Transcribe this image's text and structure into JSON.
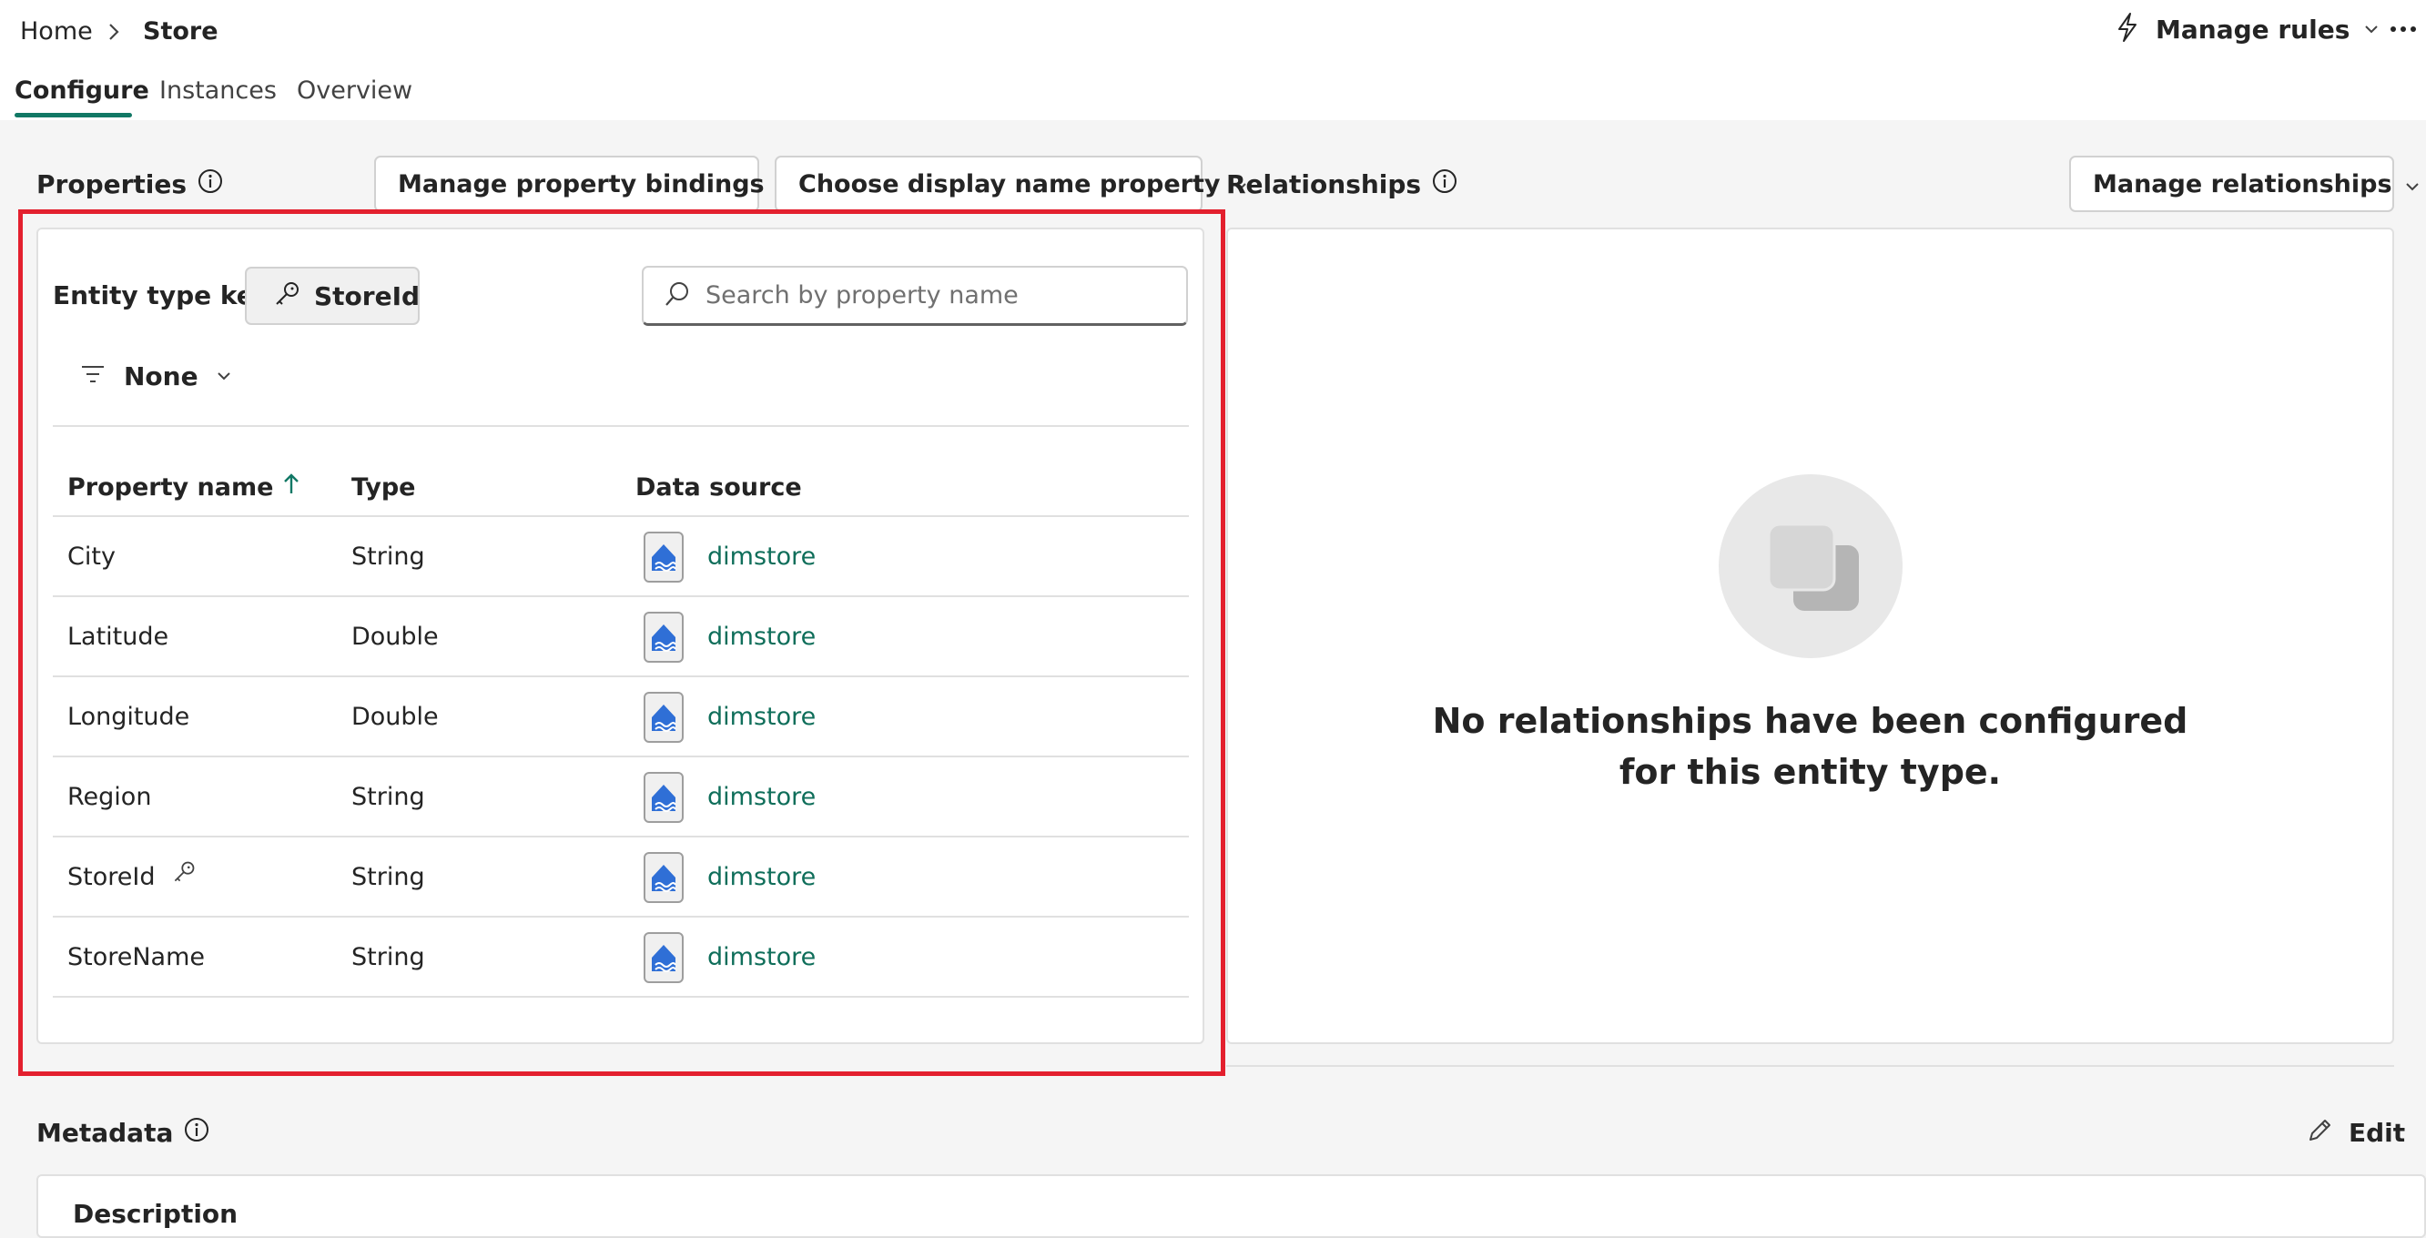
{
  "breadcrumb": {
    "home": "Home",
    "current": "Store"
  },
  "header": {
    "manage_rules": "Manage rules"
  },
  "tabs": [
    {
      "label": "Configure",
      "active": true
    },
    {
      "label": "Instances",
      "active": false
    },
    {
      "label": "Overview",
      "active": false
    }
  ],
  "properties": {
    "title": "Properties",
    "manage_bindings": "Manage property bindings",
    "choose_display": "Choose display name property",
    "entity_key_label": "Entity type key",
    "entity_key_value": "StoreId",
    "search_placeholder": "Search by property name",
    "filter_label": "None",
    "columns": {
      "name": "Property name",
      "type": "Type",
      "source": "Data source"
    },
    "rows": [
      {
        "name": "City",
        "type": "String",
        "source": "dimstore",
        "is_key": false
      },
      {
        "name": "Latitude",
        "type": "Double",
        "source": "dimstore",
        "is_key": false
      },
      {
        "name": "Longitude",
        "type": "Double",
        "source": "dimstore",
        "is_key": false
      },
      {
        "name": "Region",
        "type": "String",
        "source": "dimstore",
        "is_key": false
      },
      {
        "name": "StoreId",
        "type": "String",
        "source": "dimstore",
        "is_key": true
      },
      {
        "name": "StoreName",
        "type": "String",
        "source": "dimstore",
        "is_key": false
      }
    ]
  },
  "relationships": {
    "title": "Relationships",
    "manage": "Manage relationships",
    "empty_line1": "No relationships have been configured",
    "empty_line2": "for this entity type."
  },
  "metadata": {
    "title": "Metadata",
    "edit": "Edit",
    "description_label": "Description"
  },
  "colors": {
    "accent": "#117865",
    "link": "#0f6e5a",
    "highlight": "#e3202e",
    "datasource_icon": "#2f6fd6"
  },
  "icons": [
    "chevron-right-icon",
    "lightning-icon",
    "chevron-down-icon",
    "more-icon",
    "info-icon",
    "key-icon",
    "search-icon",
    "filter-icon",
    "sort-up-arrow-icon",
    "datasource-icon",
    "pencil-icon"
  ]
}
